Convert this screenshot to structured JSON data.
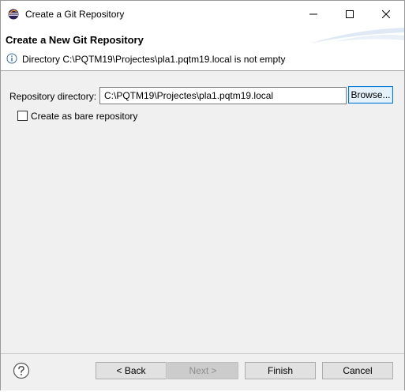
{
  "window": {
    "title": "Create a Git Repository"
  },
  "header": {
    "title": "Create a New Git Repository",
    "message": "Directory C:\\PQTM19\\Projectes\\pla1.pqtm19.local is not empty",
    "message_icon": "info-icon"
  },
  "form": {
    "repo_label": "Repository directory:",
    "repo_value": "C:\\PQTM19\\Projectes\\pla1.pqtm19.local",
    "browse_label": "Browse...",
    "bare_label": "Create as bare repository",
    "bare_checked": false
  },
  "footer": {
    "back_label": "< Back",
    "next_label": "Next >",
    "finish_label": "Finish",
    "cancel_label": "Cancel"
  },
  "colors": {
    "accent": "#0078d7",
    "info": "#3a6ea5"
  }
}
